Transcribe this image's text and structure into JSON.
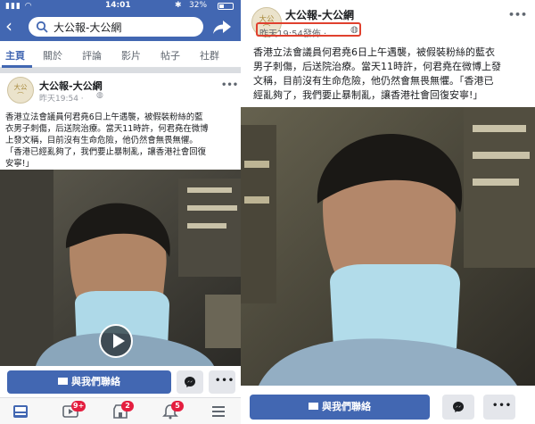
{
  "left": {
    "status": {
      "time": "14:01",
      "battery": "32%"
    },
    "search_query": "大公報-大公網",
    "tabs": [
      "主頁",
      "關於",
      "評論",
      "影片",
      "帖子",
      "社群"
    ],
    "post": {
      "page_name": "大公報-大公網",
      "meta": "昨天19:54 ·",
      "text_lines": [
        "香港立法會議員何君堯6日上午遇襲，被假裝粉絲的藍",
        "衣男子刺傷，后送院治療。當天11時許，何君堯在微博",
        "上發文稱，目前沒有生命危險，他仍然會無畏無懼。",
        "「香港已經亂夠了，我們要止暴制亂，讓香港社會回復",
        "安寧!」"
      ]
    },
    "contact_label": "與我們聯絡",
    "more_label": "•••",
    "nav_badges": {
      "videos": "9+",
      "marketplace": "2",
      "notifications": "5"
    }
  },
  "right": {
    "post": {
      "page_name": "大公報-大公網",
      "meta": "昨天19:54發佈 ·",
      "text_lines": [
        "香港立法會議員何君堯6日上午遇襲，被假裝粉絲的藍衣",
        "男子刺傷，后送院治療。當天11時許，何君堯在微博上發",
        "文稱，目前沒有生命危險，他仍然會無畏無懼。「香港已",
        "經亂夠了，我們要止暴制亂，讓香港社會回復安寧!」"
      ]
    },
    "contact_label": "與我們聯絡",
    "more_label": "•••"
  },
  "avatar_glyph": "大公",
  "colors": {
    "brand": "#4267b2",
    "highlight": "#e0402e",
    "badge": "#e41e3f"
  }
}
